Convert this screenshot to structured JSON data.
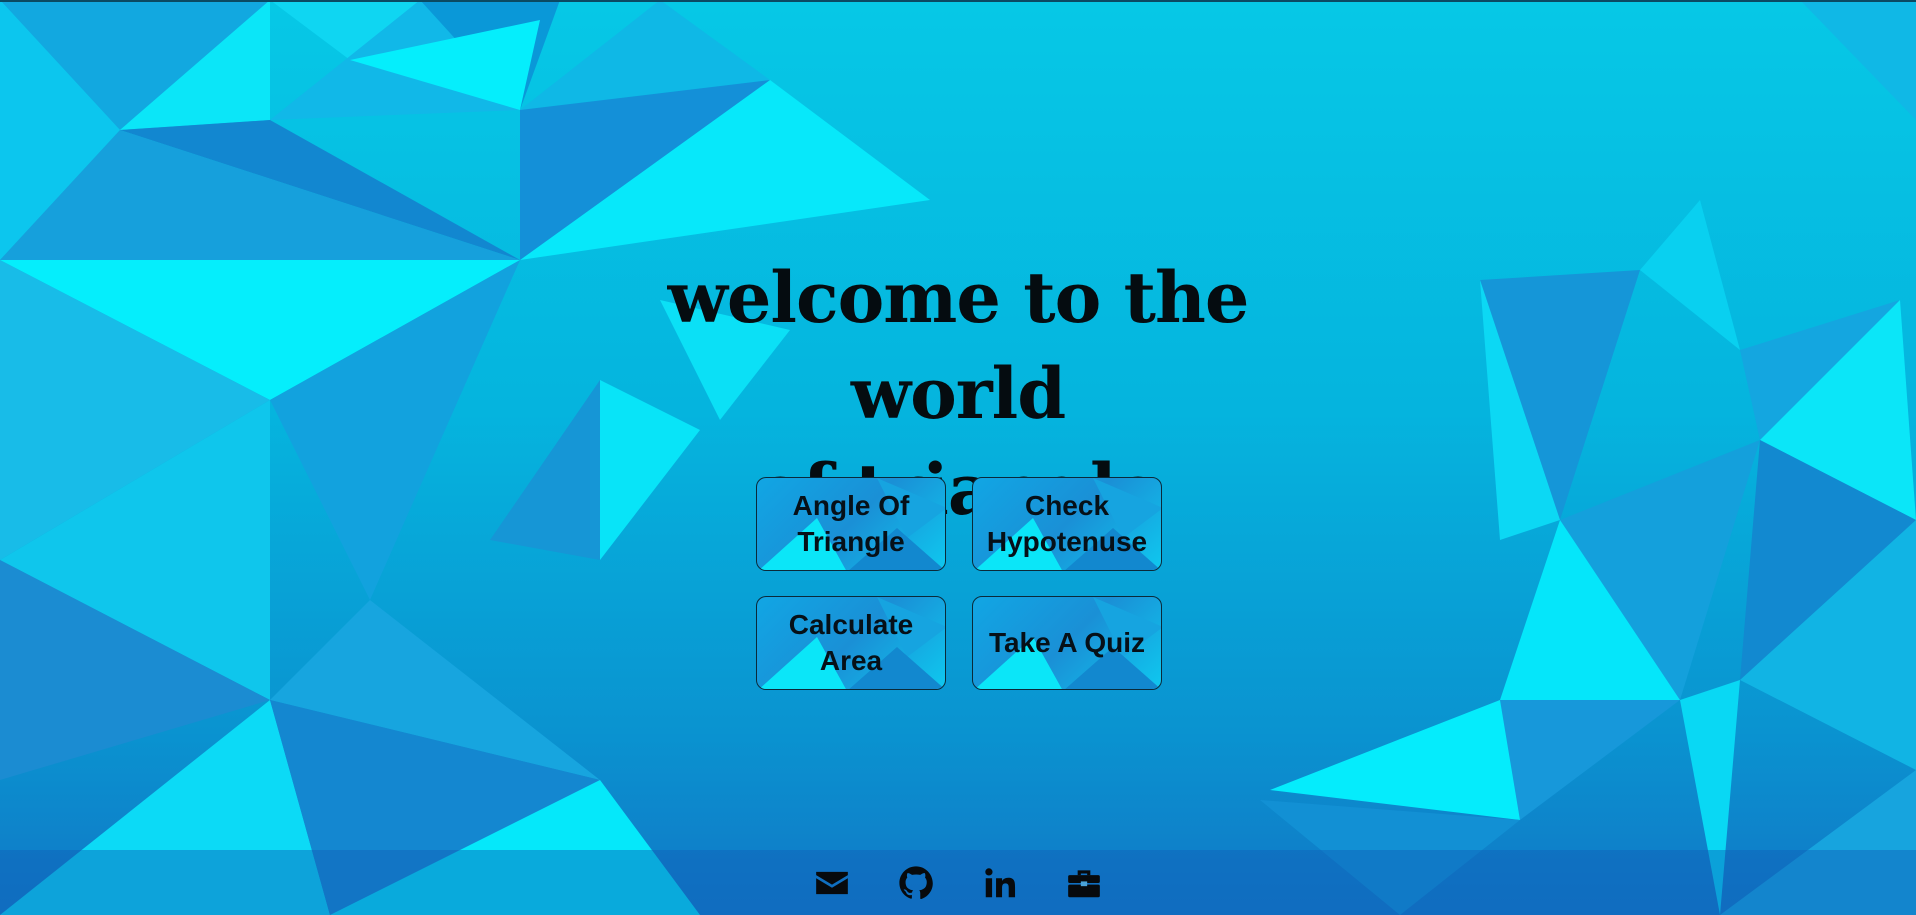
{
  "hero": {
    "title_line1": "welcome to the world",
    "title_line2": "of triangle"
  },
  "buttons": [
    {
      "label": "Angle Of Triangle"
    },
    {
      "label": "Check Hypotenuse"
    },
    {
      "label": "Calculate Area"
    },
    {
      "label": "Take A Quiz"
    }
  ],
  "footer": {
    "icons": [
      "mail-icon",
      "github-icon",
      "linkedin-icon",
      "briefcase-icon"
    ]
  },
  "colors": {
    "background": "#05b4de",
    "text": "#050c10",
    "footer": "#0f5fb9"
  }
}
